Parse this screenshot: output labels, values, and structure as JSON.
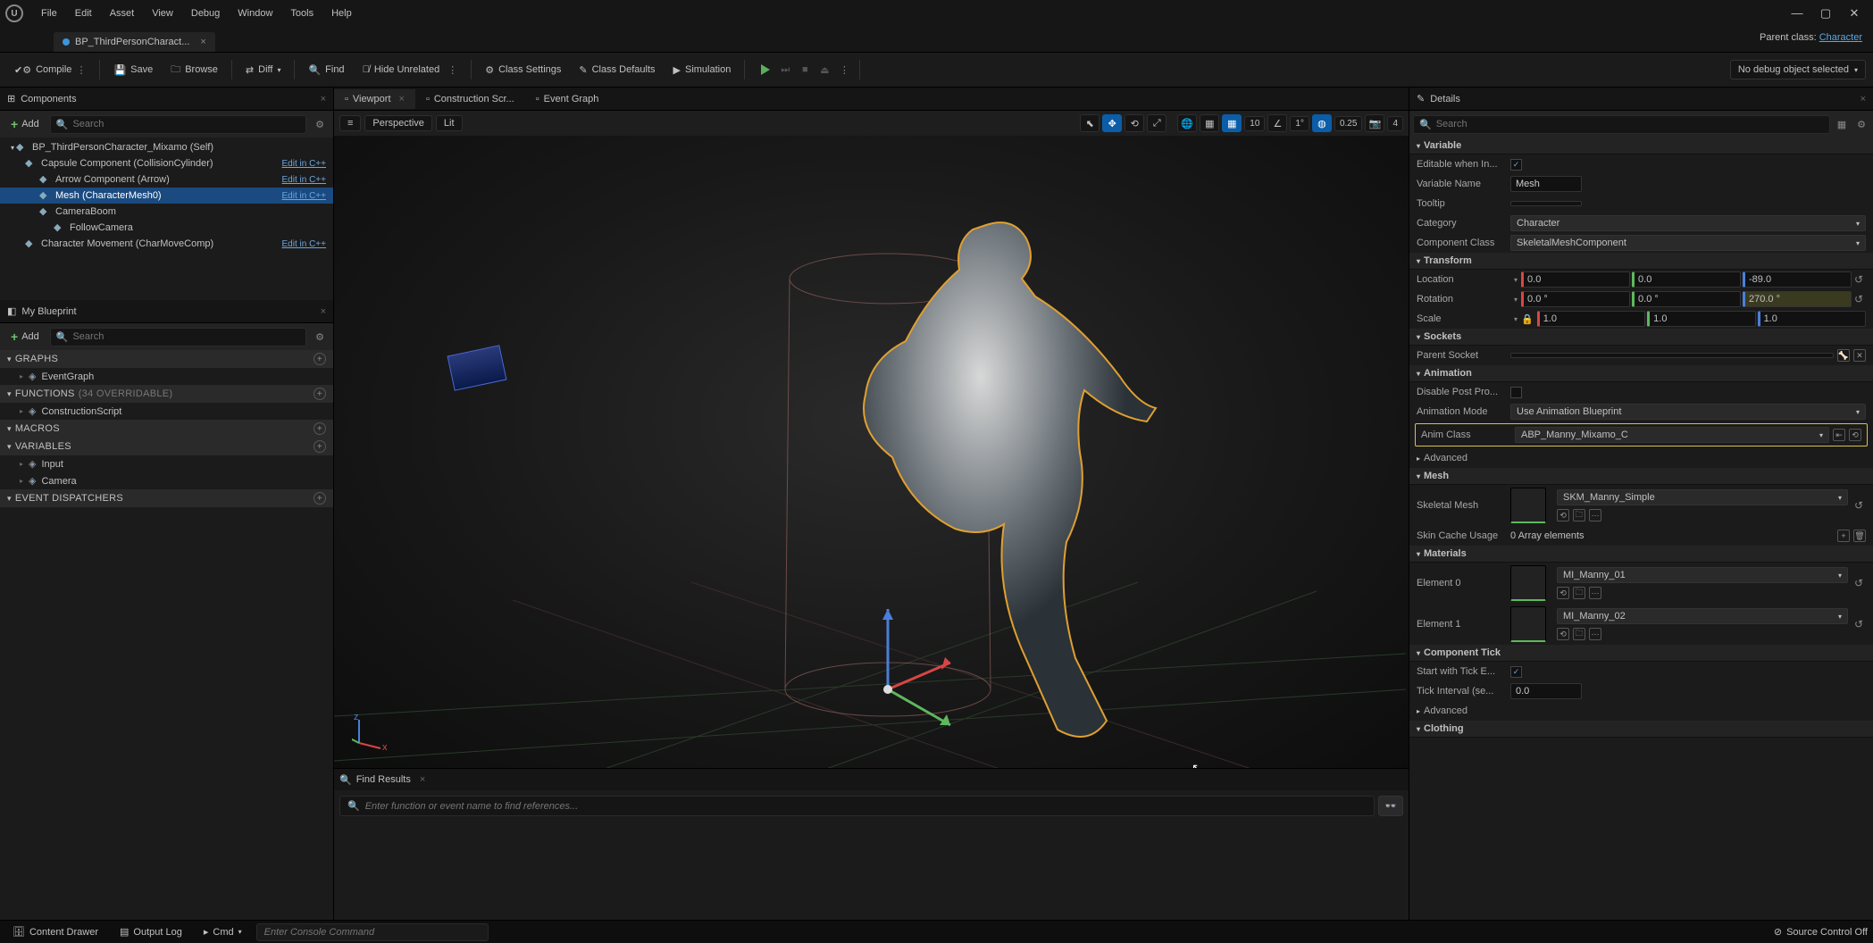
{
  "menubar": [
    "File",
    "Edit",
    "Asset",
    "View",
    "Debug",
    "Window",
    "Tools",
    "Help"
  ],
  "doc_tab": {
    "title": "BP_ThirdPersonCharact...",
    "close": "×"
  },
  "parent_class": {
    "label": "Parent class:",
    "value": "Character"
  },
  "toolbar": {
    "compile": "Compile",
    "save": "Save",
    "browse": "Browse",
    "diff": "Diff",
    "find": "Find",
    "hide_unrelated": "Hide Unrelated",
    "class_settings": "Class Settings",
    "class_defaults": "Class Defaults",
    "simulation": "Simulation",
    "debug_combo": "No debug object selected"
  },
  "components": {
    "title": "Components",
    "add": "Add",
    "search_ph": "Search",
    "tree": [
      {
        "indent": 0,
        "label": "BP_ThirdPersonCharacter_Mixamo (Self)",
        "icon": "bp",
        "edit": ""
      },
      {
        "indent": 1,
        "label": "Capsule Component (CollisionCylinder)",
        "icon": "capsule",
        "edit": "Edit in C++"
      },
      {
        "indent": 2,
        "label": "Arrow Component (Arrow)",
        "icon": "arrow",
        "edit": "Edit in C++"
      },
      {
        "indent": 2,
        "label": "Mesh (CharacterMesh0)",
        "icon": "mesh",
        "edit": "Edit in C++",
        "selected": true
      },
      {
        "indent": 2,
        "label": "CameraBoom",
        "icon": "spring",
        "edit": ""
      },
      {
        "indent": 3,
        "label": "FollowCamera",
        "icon": "camera",
        "edit": ""
      },
      {
        "indent": 1,
        "label": "Character Movement (CharMoveComp)",
        "icon": "move",
        "edit": "Edit in C++"
      }
    ]
  },
  "myblueprint": {
    "title": "My Blueprint",
    "add": "Add",
    "search_ph": "Search",
    "sections": [
      {
        "name": "GRAPHS",
        "items": [
          {
            "label": "EventGraph",
            "icon": "graph"
          }
        ]
      },
      {
        "name": "FUNCTIONS",
        "sub": "(34 OVERRIDABLE)",
        "items": [
          {
            "label": "ConstructionScript",
            "icon": "func"
          }
        ]
      },
      {
        "name": "MACROS",
        "items": []
      },
      {
        "name": "VARIABLES",
        "items": [
          {
            "label": "Input",
            "icon": "folder"
          },
          {
            "label": "Camera",
            "icon": "folder"
          }
        ]
      },
      {
        "name": "EVENT DISPATCHERS",
        "items": []
      }
    ]
  },
  "center_tabs": [
    {
      "label": "Viewport",
      "icon": "vp",
      "active": true,
      "closable": true
    },
    {
      "label": "Construction Scr...",
      "icon": "func"
    },
    {
      "label": "Event Graph",
      "icon": "graph"
    }
  ],
  "viewport_bar": {
    "perspective": "Perspective",
    "lit": "Lit",
    "snap_grid": "10",
    "snap_angle": "1°",
    "scale_snap": "0.25",
    "cam_speed": "4"
  },
  "find": {
    "title": "Find Results",
    "placeholder": "Enter function or event name to find references..."
  },
  "details": {
    "title": "Details",
    "search_ph": "Search",
    "cats": [
      {
        "name": "Variable",
        "rows": [
          {
            "label": "Editable when In...",
            "type": "check",
            "value": true
          },
          {
            "label": "Variable Name",
            "type": "text",
            "value": "Mesh"
          },
          {
            "label": "Tooltip",
            "type": "text",
            "value": ""
          },
          {
            "label": "Category",
            "type": "combo",
            "value": "Character"
          },
          {
            "label": "Component Class",
            "type": "combo",
            "value": "SkeletalMeshComponent"
          }
        ]
      },
      {
        "name": "Transform",
        "rows": [
          {
            "label": "Location",
            "type": "vec3",
            "x": "0.0",
            "y": "0.0",
            "z": "-89.0",
            "reset": true
          },
          {
            "label": "Rotation",
            "type": "vec3",
            "x": "0.0 °",
            "y": "0.0 °",
            "z": "270.0 °",
            "reset": true,
            "z_hl": true
          },
          {
            "label": "Scale",
            "type": "vec3",
            "x": "1.0",
            "y": "1.0",
            "z": "1.0",
            "lock": true
          }
        ]
      },
      {
        "name": "Sockets",
        "rows": [
          {
            "label": "Parent Socket",
            "type": "socket"
          }
        ]
      },
      {
        "name": "Animation",
        "rows": [
          {
            "label": "Disable Post Pro...",
            "type": "check",
            "value": false
          },
          {
            "label": "Animation Mode",
            "type": "combo",
            "value": "Use Animation Blueprint"
          },
          {
            "label": "Anim Class",
            "type": "combo",
            "value": "ABP_Manny_Mixamo_C",
            "highlight": true,
            "extra_icons": true
          },
          {
            "label": "Advanced",
            "type": "expand"
          }
        ]
      },
      {
        "name": "Mesh",
        "rows": [
          {
            "label": "Skeletal Mesh",
            "type": "asset",
            "value": "SKM_Manny_Simple"
          },
          {
            "label": "Skin Cache Usage",
            "type": "array",
            "value": "0 Array elements"
          }
        ]
      },
      {
        "name": "Materials",
        "rows": [
          {
            "label": "Element 0",
            "type": "asset",
            "value": "MI_Manny_01"
          },
          {
            "label": "Element 1",
            "type": "asset",
            "value": "MI_Manny_02"
          }
        ]
      },
      {
        "name": "Component Tick",
        "rows": [
          {
            "label": "Start with Tick E...",
            "type": "check",
            "value": true
          },
          {
            "label": "Tick Interval (se...",
            "type": "text",
            "value": "0.0"
          },
          {
            "label": "Advanced",
            "type": "expand"
          }
        ]
      },
      {
        "name": "Clothing",
        "rows": []
      }
    ]
  },
  "statusbar": {
    "content_drawer": "Content Drawer",
    "output_log": "Output Log",
    "cmd_label": "Cmd",
    "cmd_ph": "Enter Console Command",
    "source_control": "Source Control Off"
  }
}
